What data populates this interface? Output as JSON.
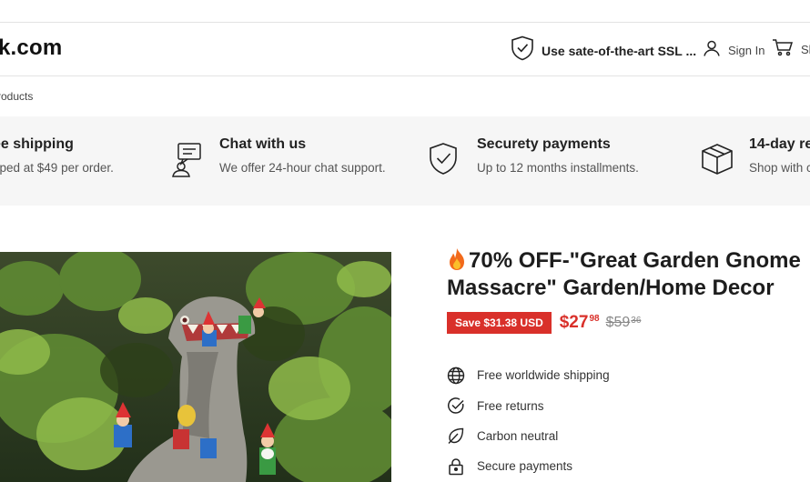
{
  "header": {
    "logo": "k.com",
    "ssl_text": "Use sate-of-the-art SSL ...",
    "signin_label": "Sign In",
    "cart_label": "Sh"
  },
  "breadcrumb": "roducts",
  "features": [
    {
      "title": "ee shipping",
      "desc": "pped at $49 per order.",
      "icon": "truck-icon"
    },
    {
      "title": "Chat with us",
      "desc": "We offer 24-hour chat support.",
      "icon": "chat-icon"
    },
    {
      "title": "Securety payments",
      "desc": "Up to 12 months installments.",
      "icon": "shield-check-icon"
    },
    {
      "title": "14-day re",
      "desc": "Shop with c",
      "icon": "box-icon"
    }
  ],
  "product": {
    "title": "70% OFF-\"Great Garden Gnome Massacre\" Garden/Home Decor",
    "save_badge": "Save $31.38 USD",
    "price_main": "$27",
    "price_cents": "98",
    "old_price_main": "$59",
    "old_price_cents": "36",
    "benefits": [
      {
        "label": "Free worldwide shipping",
        "icon": "globe-icon"
      },
      {
        "label": "Free returns",
        "icon": "check-circle-icon"
      },
      {
        "label": "Carbon neutral",
        "icon": "leaf-icon"
      },
      {
        "label": "Secure payments",
        "icon": "lock-icon"
      }
    ]
  },
  "colors": {
    "accent_red": "#d9302a",
    "feature_bg": "#f6f6f6"
  }
}
